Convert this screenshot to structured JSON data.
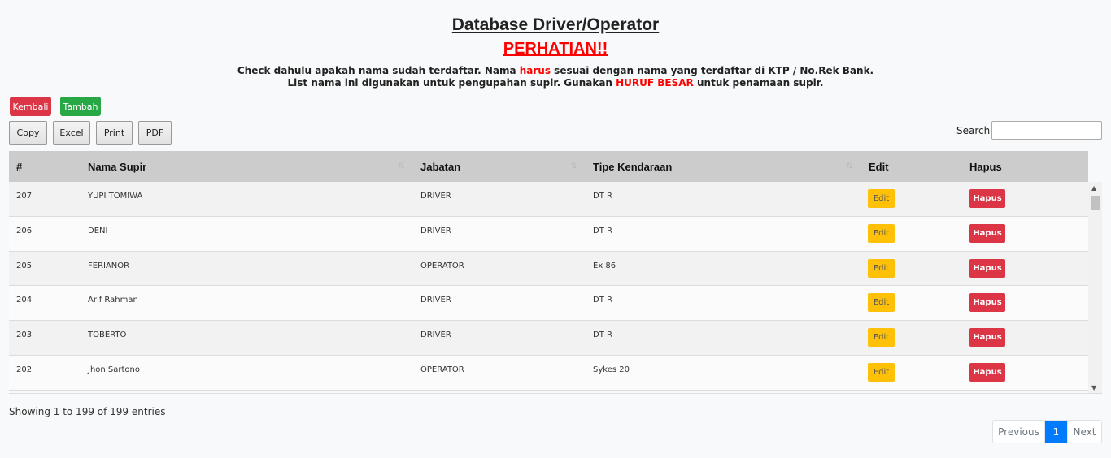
{
  "header": {
    "title": "Database Driver/Operator",
    "warning": "PERHATIAN!!",
    "line1_a": "Check dahulu apakah nama sudah terdaftar. Nama ",
    "line1_red": "harus",
    "line1_b": " sesuai dengan nama yang terdaftar di KTP / No.Rek Bank.",
    "line2_a": "List nama ini digunakan untuk pengupahan supir. Gunakan ",
    "line2_red": "HURUF BESAR",
    "line2_b": " untuk penamaan supir."
  },
  "actions": {
    "back_label": "Kembali",
    "add_label": "Tambah"
  },
  "export": {
    "copy": "Copy",
    "excel": "Excel",
    "print": "Print",
    "pdf": "PDF"
  },
  "search": {
    "label": "Search:",
    "value": ""
  },
  "table": {
    "headers": {
      "no": "#",
      "name": "Nama Supir",
      "position": "Jabatan",
      "vehicle": "Tipe Kendaraan",
      "edit": "Edit",
      "delete": "Hapus"
    },
    "rows": [
      {
        "no": "207",
        "name": "YUPI TOMIWA",
        "position": "DRIVER",
        "vehicle": "DT R",
        "edit": "Edit",
        "delete": "Hapus"
      },
      {
        "no": "206",
        "name": "DENI",
        "position": "DRIVER",
        "vehicle": "DT R",
        "edit": "Edit",
        "delete": "Hapus"
      },
      {
        "no": "205",
        "name": "FERIANOR",
        "position": "OPERATOR",
        "vehicle": "Ex 86",
        "edit": "Edit",
        "delete": "Hapus"
      },
      {
        "no": "204",
        "name": "Arif Rahman",
        "position": "DRIVER",
        "vehicle": "DT R",
        "edit": "Edit",
        "delete": "Hapus"
      },
      {
        "no": "203",
        "name": "TOBERTO",
        "position": "DRIVER",
        "vehicle": "DT R",
        "edit": "Edit",
        "delete": "Hapus"
      },
      {
        "no": "202",
        "name": "Jhon Sartono",
        "position": "OPERATOR",
        "vehicle": "Sykes 20",
        "edit": "Edit",
        "delete": "Hapus"
      }
    ]
  },
  "footer": {
    "info": "Showing 1 to 199 of 199 entries",
    "pagination": {
      "previous": "Previous",
      "current": "1",
      "next": "Next"
    }
  },
  "colors": {
    "danger": "#dc3545",
    "success": "#28a745",
    "warning": "#ffc107",
    "primary": "#007bff",
    "alert_text": "#ff0000"
  }
}
